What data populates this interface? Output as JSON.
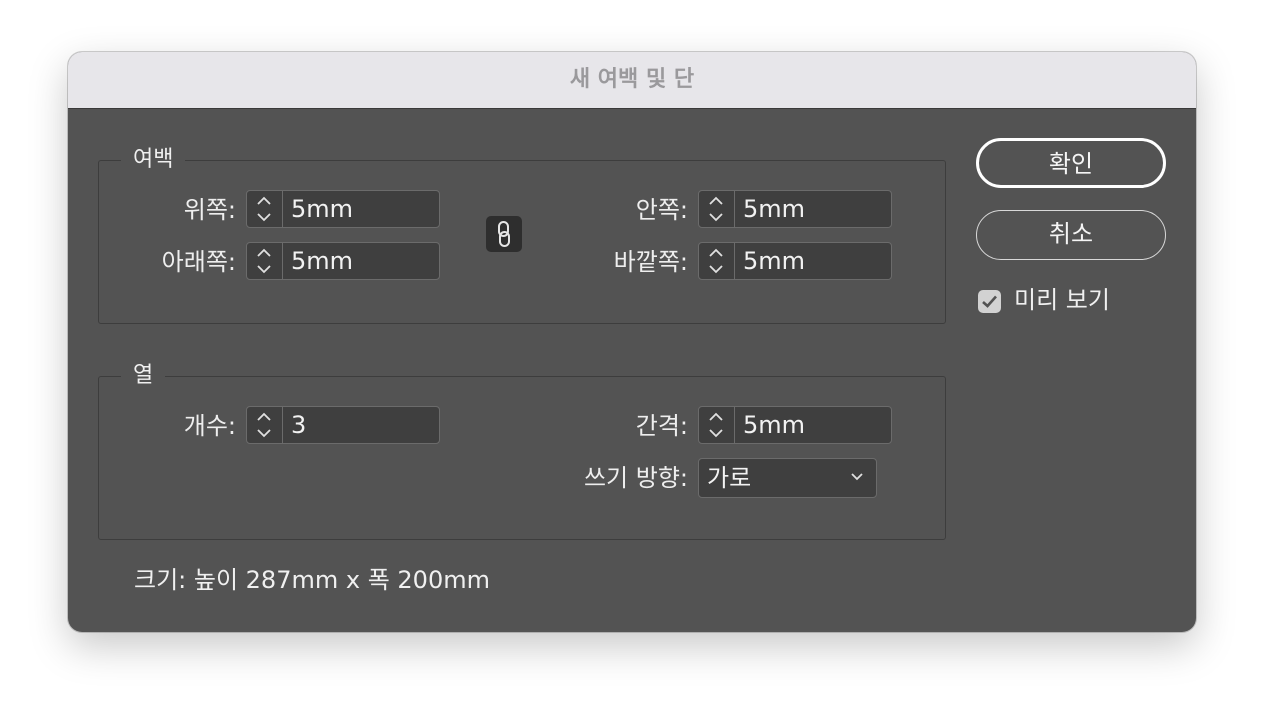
{
  "dialog": {
    "title": "새 여백 및 단"
  },
  "margins": {
    "legend": "여백",
    "top_label": "위쪽:",
    "top_value": "5mm",
    "bottom_label": "아래쪽:",
    "bottom_value": "5mm",
    "inside_label": "안쪽:",
    "inside_value": "5mm",
    "outside_label": "바깥쪽:",
    "outside_value": "5mm",
    "link_icon": "chain-link-icon"
  },
  "columns": {
    "legend": "열",
    "count_label": "개수:",
    "count_value": "3",
    "gutter_label": "간격:",
    "gutter_value": "5mm",
    "direction_label": "쓰기 방향:",
    "direction_value": "가로"
  },
  "buttons": {
    "ok": "확인",
    "cancel": "취소"
  },
  "preview": {
    "label": "미리 보기",
    "checked": true
  },
  "size_info": "크기: 높이 287mm x 폭 200mm"
}
